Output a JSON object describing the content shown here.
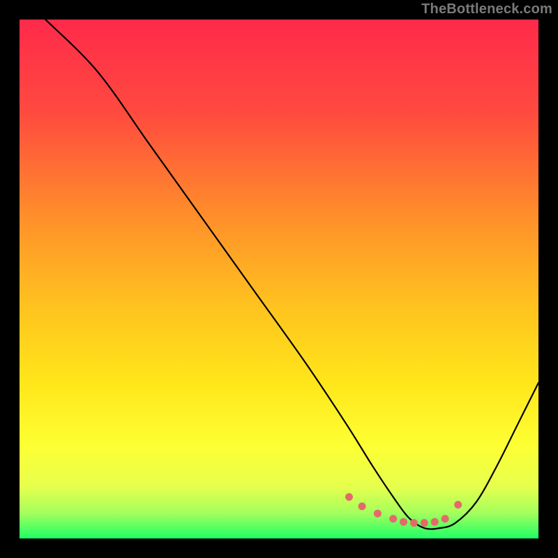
{
  "watermark": "TheBottleneck.com",
  "chart_data": {
    "type": "line",
    "title": "",
    "xlabel": "",
    "ylabel": "",
    "xlim": [
      0,
      100
    ],
    "ylim": [
      0,
      100
    ],
    "grid": false,
    "legend": false,
    "series": [
      {
        "name": "curve",
        "color": "#000000",
        "x": [
          5,
          15,
          25,
          35,
          45,
          55,
          63,
          68,
          72,
          75,
          78,
          81,
          84,
          88,
          92,
          96,
          100
        ],
        "y": [
          100,
          90,
          76,
          62,
          48,
          34,
          22,
          14,
          8,
          4,
          2,
          2,
          3,
          7,
          14,
          22,
          30
        ]
      }
    ],
    "markers": {
      "name": "dots",
      "color": "#e46a6a",
      "x": [
        63.5,
        66,
        69,
        72,
        74,
        76,
        78,
        80,
        82,
        84.5
      ],
      "y": [
        8,
        6.2,
        4.8,
        3.8,
        3.2,
        3,
        3,
        3.2,
        3.8,
        6.5
      ]
    },
    "gradient_stops": [
      {
        "offset": 0.0,
        "color": "#ff2a4a"
      },
      {
        "offset": 0.18,
        "color": "#ff4a3f"
      },
      {
        "offset": 0.38,
        "color": "#ff8f2a"
      },
      {
        "offset": 0.55,
        "color": "#ffc21f"
      },
      {
        "offset": 0.7,
        "color": "#ffe61a"
      },
      {
        "offset": 0.82,
        "color": "#fdff33"
      },
      {
        "offset": 0.9,
        "color": "#e6ff4d"
      },
      {
        "offset": 0.95,
        "color": "#a6ff5c"
      },
      {
        "offset": 1.0,
        "color": "#1fff66"
      }
    ]
  }
}
